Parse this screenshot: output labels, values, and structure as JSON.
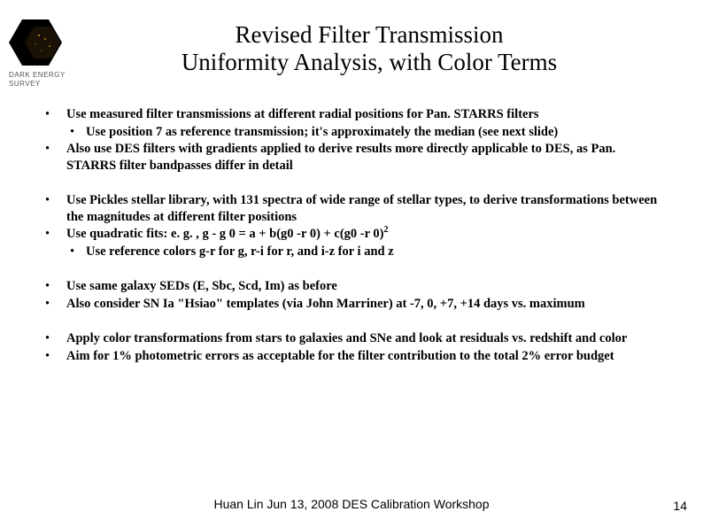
{
  "logo": {
    "label_line1": "DARK ENERGY",
    "label_line2": "SURVEY"
  },
  "title_line1": "Revised Filter Transmission",
  "title_line2": "Uniformity Analysis, with Color Terms",
  "groups": [
    {
      "items": [
        {
          "text": "Use measured filter transmissions at different radial positions for Pan. STARRS filters",
          "sub": [
            "Use position 7 as reference transmission;  it's approximately the median (see next slide)"
          ]
        },
        {
          "text": "Also use DES filters with gradients applied to derive results more directly applicable to DES, as Pan. STARRS filter bandpasses differ in detail"
        }
      ]
    },
    {
      "items": [
        {
          "text": "Use Pickles stellar library, with 131 spectra of wide range of stellar types, to derive transformations between the magnitudes at different filter positions"
        },
        {
          "html": "Use quadratic fits:  e. g. ,  g - g 0 = a + b(g0 -r 0) + c(g0 -r 0)<span class=\"sup\">2</span>",
          "sub": [
            "Use reference colors g-r for g,  r-i for r,  and i-z for i and z"
          ]
        }
      ]
    },
    {
      "items": [
        {
          "text": "Use same galaxy SEDs (E, Sbc, Scd, Im) as before"
        },
        {
          "text": "Also consider SN Ia \"Hsiao\" templates (via John Marriner) at -7, 0, +7, +14 days vs. maximum"
        }
      ]
    },
    {
      "items": [
        {
          "text": "Apply color transformations from stars to galaxies and SNe and look at residuals vs. redshift and color"
        },
        {
          "text": "Aim for 1% photometric errors as acceptable for the filter contribution to the total 2% error budget"
        }
      ]
    }
  ],
  "footer": "Huan Lin   Jun 13, 2008   DES Calibration Workshop",
  "page_number": "14"
}
